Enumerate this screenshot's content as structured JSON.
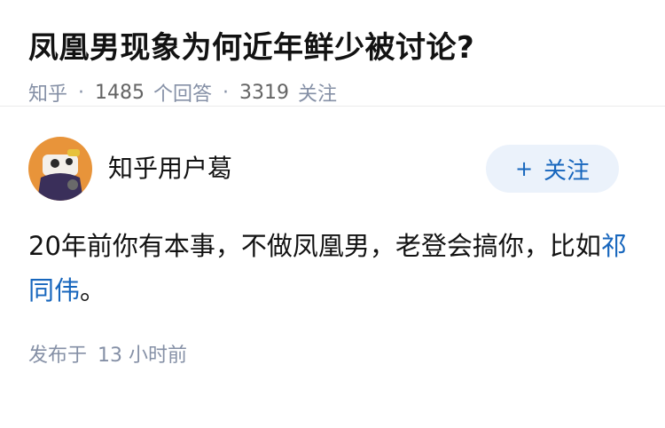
{
  "question": {
    "title": "凤凰男现象为何近年鲜少被讨论?",
    "source": "知乎",
    "answers_count": "1485",
    "answers_label": "个回答",
    "followers_count": "3319",
    "followers_label": "关注"
  },
  "answer": {
    "author_name": "知乎用户葛",
    "follow_label": "关注",
    "follow_icon": "plus-icon",
    "text_main": "20年前你有本事，不做凤凰男，老登会搞你，比如",
    "text_link": "祁同伟",
    "text_end": "。",
    "published_label": "发布于",
    "published_time": "13 小时前"
  },
  "colors": {
    "link": "#1766bd",
    "meta": "#8590a6",
    "follow_bg": "#ebf2fb",
    "avatar_bg": "#e8943a"
  }
}
